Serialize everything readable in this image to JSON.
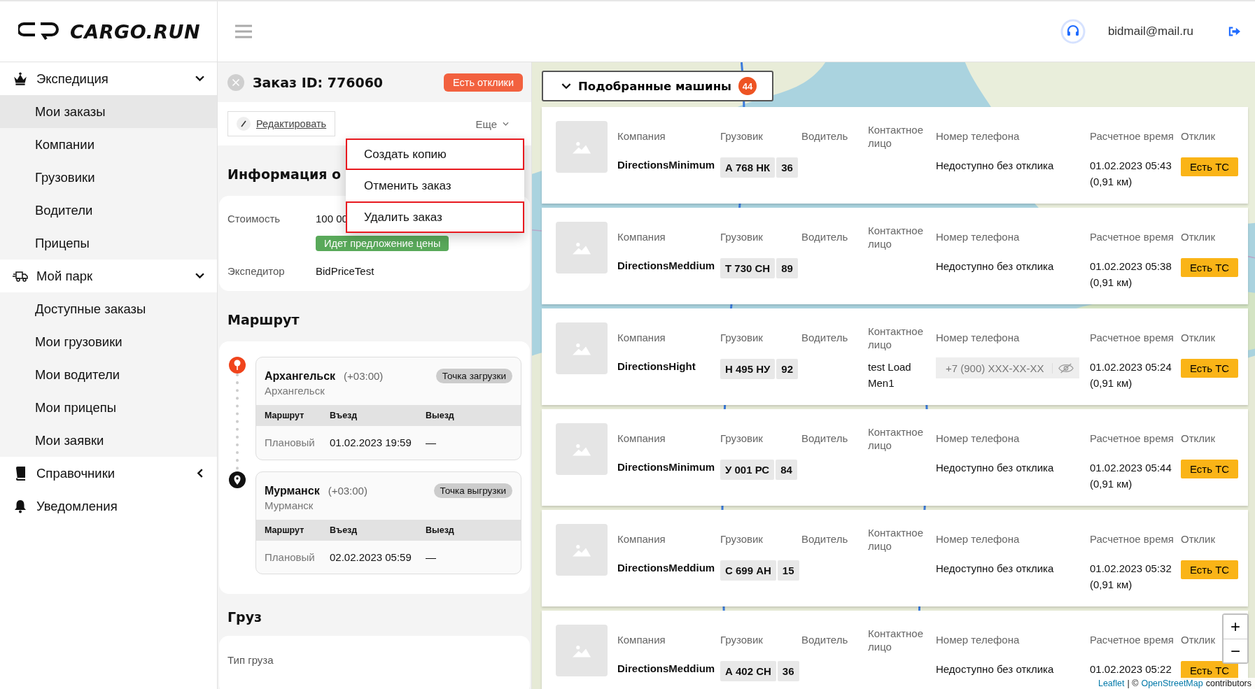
{
  "header": {
    "logo": "CARGO.RUN",
    "email": "bidmail@mail.ru"
  },
  "sidebar": {
    "items": [
      {
        "kind": "group",
        "label": "Экспедиция",
        "expanded": true,
        "children": [
          {
            "label": "Мои заказы",
            "selected": true
          },
          {
            "label": "Компании",
            "selected": false
          },
          {
            "label": "Грузовики",
            "selected": false
          },
          {
            "label": "Водители",
            "selected": false
          },
          {
            "label": "Прицепы",
            "selected": false
          }
        ]
      },
      {
        "kind": "group",
        "label": "Мой парк",
        "expanded": true,
        "children": [
          {
            "label": "Доступные заказы",
            "selected": false
          },
          {
            "label": "Мои грузовики",
            "selected": false
          },
          {
            "label": "Мои водители",
            "selected": false
          },
          {
            "label": "Мои прицепы",
            "selected": false
          },
          {
            "label": "Мои заявки",
            "selected": false
          }
        ]
      },
      {
        "kind": "group",
        "label": "Справочники",
        "expanded": false
      },
      {
        "kind": "link",
        "label": "Уведомления"
      }
    ]
  },
  "order": {
    "title": "Заказ ID: 776060",
    "status_badge": "Есть отклики",
    "edit_button": "Редактировать",
    "more_button": "Еще",
    "menu": [
      {
        "label": "Создать копию",
        "highlighted": true
      },
      {
        "label": "Отменить заказ",
        "highlighted": false
      },
      {
        "label": "Удалить заказ",
        "highlighted": true
      }
    ],
    "info": {
      "title": "Информация о",
      "fields": [
        {
          "label": "Стоимость",
          "value": "100 00",
          "badge": "Идет предложение цены"
        },
        {
          "label": "Экспедитор",
          "value": "BidPriceTest"
        }
      ]
    },
    "route": {
      "title": "Маршрут",
      "points": [
        {
          "kind": "loading",
          "city": "Архангельск",
          "timezone": "(+03:00)",
          "address": "Архангельск",
          "type_label": "Точка загрузки",
          "columns": [
            "Маршрут",
            "Въезд",
            "Выезд"
          ],
          "row": [
            "Плановый",
            "01.02.2023 19:59",
            "—"
          ]
        },
        {
          "kind": "unloading",
          "city": "Мурманск",
          "timezone": "(+03:00)",
          "address": "Мурманск",
          "type_label": "Точка выгрузки",
          "columns": [
            "Маршрут",
            "Въезд",
            "Выезд"
          ],
          "row": [
            "Плановый",
            "02.02.2023 05:59",
            "—"
          ]
        }
      ]
    },
    "cargo": {
      "title": "Груз",
      "fields": [
        "Тип груза"
      ]
    }
  },
  "matches": {
    "title": "Подобранные машины",
    "count": "44",
    "expanded": true,
    "vehicles": [
      {
        "labels": [
          "Компания",
          "Грузовик",
          "Водитель",
          "Контактное лицо",
          "Номер телефона",
          "Расчетное время",
          "Отклик"
        ],
        "company": "DirectionsMinimum",
        "plate": "А 768 НК",
        "region": "36",
        "phone": {
          "kind": "text",
          "text": "Недоступно без отклика"
        },
        "time": "01.02.2023 05:43",
        "distance": "(0,91 км)",
        "response": "Есть ТС"
      },
      {
        "labels": [
          "Компания",
          "Грузовик",
          "Водитель",
          "Контактное лицо",
          "Номер телефона",
          "Расчетное время",
          "Отклик"
        ],
        "company": "DirectionsMeddium",
        "plate": "Т 730 СН",
        "region": "89",
        "phone": {
          "kind": "text",
          "text": "Недоступно без отклика"
        },
        "time": "01.02.2023 05:38",
        "distance": "(0,91 км)",
        "response": "Есть ТС"
      },
      {
        "labels": [
          "Компания",
          "Грузовик",
          "Водитель",
          "Контактное лицо",
          "Номер телефона",
          "Расчетное время",
          "Отклик"
        ],
        "company": "DirectionsHight",
        "plate": "Н 495 НУ",
        "region": "92",
        "contact": "test Load Men1",
        "phone": {
          "kind": "masked",
          "text": "+7 (900) XXX-XX-XX"
        },
        "time": "01.02.2023 05:24",
        "distance": "(0,91 км)",
        "response": "Есть ТС"
      },
      {
        "labels": [
          "Компания",
          "Грузовик",
          "Водитель",
          "Контактное лицо",
          "Номер телефона",
          "Расчетное время",
          "Отклик"
        ],
        "company": "DirectionsMinimum",
        "plate": "У 001 РС",
        "region": "84",
        "phone": {
          "kind": "text",
          "text": "Недоступно без отклика"
        },
        "time": "01.02.2023 05:44",
        "distance": "(0,91 км)",
        "response": "Есть ТС"
      },
      {
        "labels": [
          "Компания",
          "Грузовик",
          "Водитель",
          "Контактное лицо",
          "Номер телефона",
          "Расчетное время",
          "Отклик"
        ],
        "company": "DirectionsMeddium",
        "plate": "С 699 АН",
        "region": "15",
        "phone": {
          "kind": "text",
          "text": "Недоступно без отклика"
        },
        "time": "01.02.2023 05:32",
        "distance": "(0,91 км)",
        "response": "Есть ТС"
      },
      {
        "labels": [
          "Компания",
          "Грузовик",
          "Водитель",
          "Контактное лицо",
          "Номер телефона",
          "Расчетное время",
          "Отклик"
        ],
        "company": "DirectionsMeddium",
        "plate": "А 402 СН",
        "region": "36",
        "phone": {
          "kind": "text",
          "text": "Недоступно без отклика"
        },
        "time": "01.02.2023 05:22",
        "response": "Есть ТС"
      }
    ]
  },
  "map": {
    "zoom_in": "+",
    "zoom_out": "−",
    "attribution": {
      "leaflet": "Leaflet",
      "separator": "| ©",
      "osm": "OpenStreetMap",
      "suffix": "contributors"
    }
  }
}
